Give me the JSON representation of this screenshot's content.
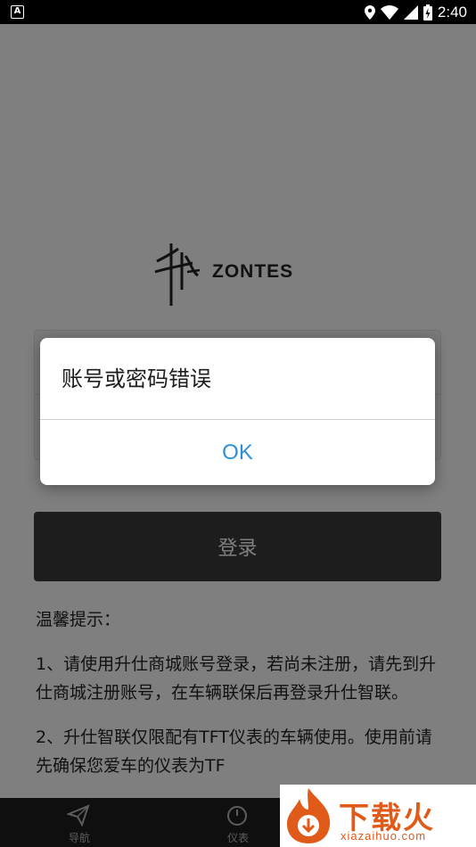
{
  "status_bar": {
    "left_icon": "A",
    "time": "2:40",
    "icons": [
      "location-icon",
      "wifi-icon",
      "signal-icon",
      "battery-icon"
    ]
  },
  "logo": {
    "brand": "ZONTES"
  },
  "form": {
    "account_placeholder": "",
    "password_placeholder": ""
  },
  "login_button": {
    "label": "登录"
  },
  "tips": {
    "title": "温馨提示：",
    "item1": "1、请使用升仕商城账号登录，若尚未注册，请先到升仕商城注册账号，在车辆联保后再登录升仕智联。",
    "item2": "2、升仕智联仅限配有TFT仪表的车辆使用。使用前请先确保您爱车的仪表为TF"
  },
  "dialog": {
    "message": "账号或密码错误",
    "ok_label": "OK"
  },
  "bottom_nav": {
    "tabs": [
      {
        "label": "导航",
        "icon": "navigation-icon"
      },
      {
        "label": "仪表",
        "icon": "gauge-icon"
      },
      {
        "label": "",
        "icon": ""
      }
    ]
  },
  "watermark": {
    "text": "下载火",
    "url": "xiazaihuo.com"
  },
  "colors": {
    "accent": "#2a8fd6",
    "button_bg": "#3b3b3b",
    "overlay": "rgba(0,0,0,0.5)"
  }
}
